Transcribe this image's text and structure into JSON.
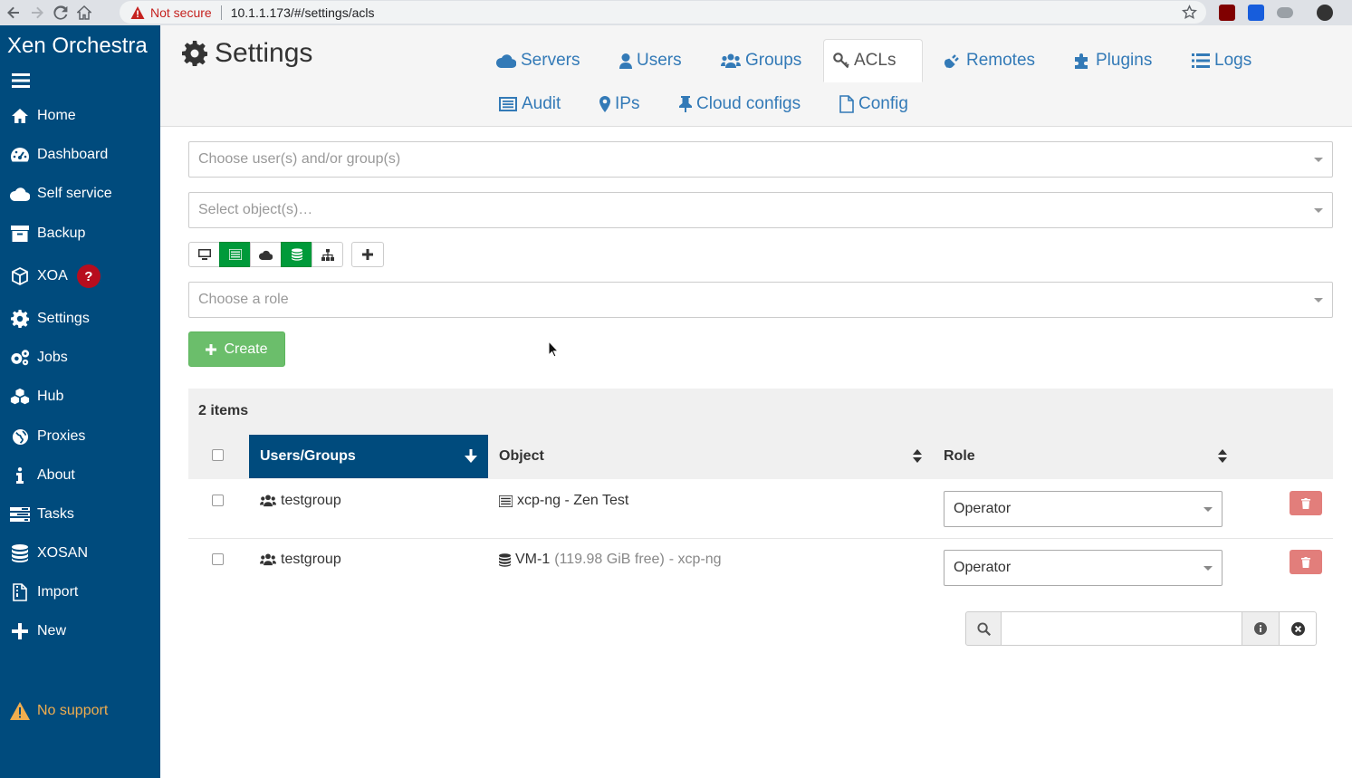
{
  "browser": {
    "security_label": "Not secure",
    "url": "10.1.1.173/#/settings/acls"
  },
  "sidebar": {
    "brand": "Xen Orchestra",
    "items": [
      {
        "label": "Home",
        "icon": "home-icon"
      },
      {
        "label": "Dashboard",
        "icon": "dashboard-icon"
      },
      {
        "label": "Self service",
        "icon": "cloud-icon"
      },
      {
        "label": "Backup",
        "icon": "archive-icon"
      },
      {
        "label": "XOA",
        "icon": "cube-icon",
        "badge": "?"
      },
      {
        "label": "Settings",
        "icon": "gear-icon"
      },
      {
        "label": "Jobs",
        "icon": "gears-icon"
      },
      {
        "label": "Hub",
        "icon": "cubes-icon"
      },
      {
        "label": "Proxies",
        "icon": "globe-icon"
      },
      {
        "label": "About",
        "icon": "info-icon"
      },
      {
        "label": "Tasks",
        "icon": "tasks-icon"
      },
      {
        "label": "XOSAN",
        "icon": "database-icon"
      },
      {
        "label": "Import",
        "icon": "file-zip-icon"
      },
      {
        "label": "New",
        "icon": "plus-icon"
      }
    ],
    "no_support": "No support"
  },
  "header": {
    "title": "Settings",
    "tabs": [
      {
        "label": "Servers",
        "icon": "cloud-icon"
      },
      {
        "label": "Users",
        "icon": "user-icon"
      },
      {
        "label": "Groups",
        "icon": "users-icon"
      },
      {
        "label": "ACLs",
        "icon": "key-icon",
        "active": true
      },
      {
        "label": "Remotes",
        "icon": "plug-icon"
      },
      {
        "label": "Plugins",
        "icon": "puzzle-icon"
      },
      {
        "label": "Logs",
        "icon": "list-icon"
      },
      {
        "label": "Audit",
        "icon": "audit-icon"
      },
      {
        "label": "IPs",
        "icon": "map-marker-icon"
      },
      {
        "label": "Cloud configs",
        "icon": "thumbtack-icon"
      },
      {
        "label": "Config",
        "icon": "file-icon"
      }
    ]
  },
  "form": {
    "subjects_placeholder": "Choose user(s) and/or group(s)",
    "objects_placeholder": "Select object(s)…",
    "role_placeholder": "Choose a role",
    "create_label": "Create"
  },
  "table": {
    "count_label": "2 items",
    "columns": [
      "Users/Groups",
      "Object",
      "Role"
    ],
    "rows": [
      {
        "subject": "testgroup",
        "object_name": "xcp-ng - Zen Test",
        "object_extra": "",
        "object_suffix": "",
        "role": "Operator"
      },
      {
        "subject": "testgroup",
        "object_name": "VM-1",
        "object_extra": "(119.98 GiB free)",
        "object_suffix": "- xcp-ng",
        "role": "Operator"
      }
    ]
  },
  "search": {
    "value": ""
  },
  "colors": {
    "sidebar_bg": "#004b7d",
    "link": "#337ab7",
    "success": "#5cb85c",
    "active_filter": "#009a3a",
    "danger": "#d9534f",
    "badge": "#b70d1e",
    "warning": "#f0ad4e"
  }
}
